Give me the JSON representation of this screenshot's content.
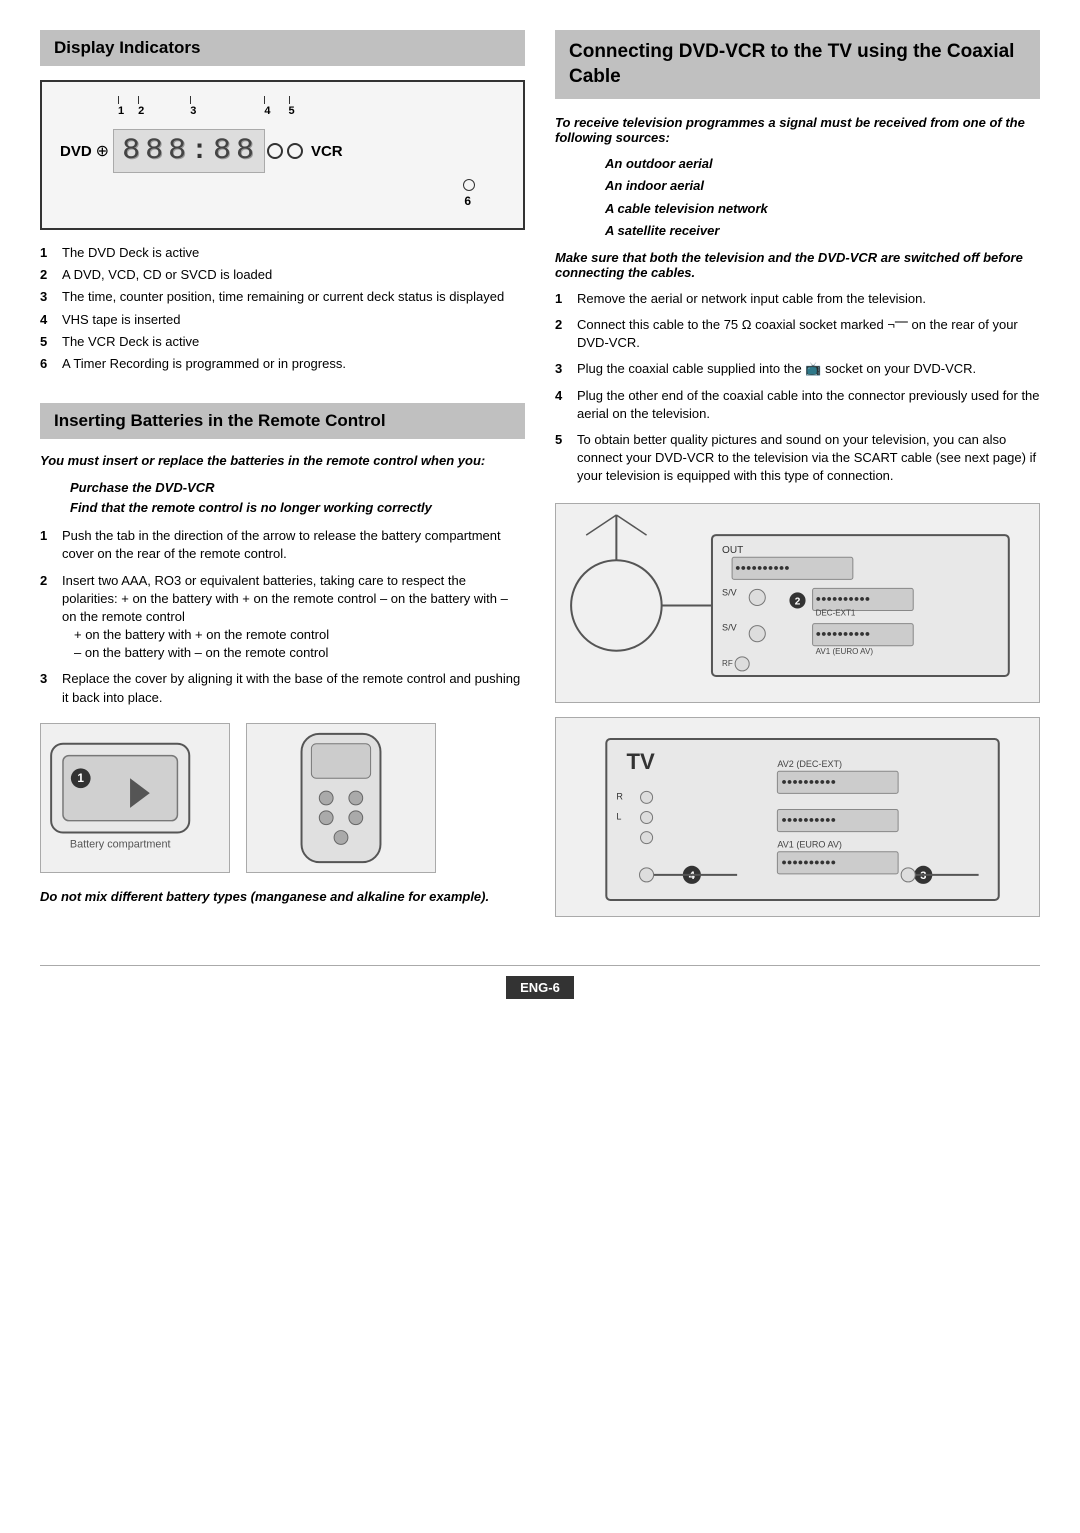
{
  "left": {
    "display_section": {
      "title": "Display Indicators",
      "indicator_numbers": [
        "1",
        "2",
        "3",
        "4",
        "5"
      ],
      "dvd_label": "DVD",
      "vcr_label": "VCR",
      "digits": [
        "8",
        "8",
        "8",
        ":",
        "8",
        "8"
      ],
      "indicator_note_6": "6",
      "items": [
        {
          "num": "1",
          "text": "The DVD Deck is active"
        },
        {
          "num": "2",
          "text": "A DVD, VCD, CD or SVCD is loaded"
        },
        {
          "num": "3",
          "text": "The time, counter position, time remaining or current deck status is displayed"
        },
        {
          "num": "4",
          "text": "VHS tape is inserted"
        },
        {
          "num": "5",
          "text": "The VCR Deck is active"
        },
        {
          "num": "6",
          "text": "A Timer Recording is programmed or in progress."
        }
      ]
    },
    "batteries_section": {
      "title": "Inserting Batteries in the Remote Control",
      "intro": "You must insert or replace the batteries in the remote control when you:",
      "conditions": [
        "Purchase the DVD-VCR",
        "Find that the remote control is no longer working correctly"
      ],
      "steps": [
        {
          "num": "1",
          "text": "Push the tab in the direction of the arrow to release the battery compartment cover on the rear of the remote control."
        },
        {
          "num": "2",
          "text": "Insert two AAA, RO3 or equivalent batteries, taking care to respect the polarities:\n+ on the battery with + on the remote control\n– on the battery with – on the remote control"
        },
        {
          "num": "3",
          "text": "Replace the cover by aligning it with the base of the remote control and pushing it back into place."
        }
      ],
      "plus_line": "+ on the battery with + on the remote control",
      "minus_line": "– on the battery with – on the remote control",
      "warning": "Do not mix different battery types (manganese and alkaline for example)."
    }
  },
  "right": {
    "connecting_section": {
      "title": "Connecting DVD-VCR to the TV using the Coaxial Cable",
      "intro": "To receive television programmes a signal must be received from one of the following sources:",
      "sources": [
        "An outdoor aerial",
        "An indoor aerial",
        "A cable television network",
        "A satellite receiver"
      ],
      "warning": "Make sure that both the television and the DVD-VCR are switched off before connecting the cables.",
      "steps": [
        {
          "num": "1",
          "text": "Remove the aerial or network input cable from the television."
        },
        {
          "num": "2",
          "text": "Connect this cable to the 75 Ω coaxial socket marked ¬― on the rear of your DVD-VCR."
        },
        {
          "num": "3",
          "text": "Plug the coaxial cable supplied into the 📺 socket on your DVD-VCR."
        },
        {
          "num": "4",
          "text": "Plug the other end of the coaxial cable into the connector previously used for the aerial on the television."
        },
        {
          "num": "5",
          "text": "To obtain better quality pictures and sound on your television, you can also connect your DVD-VCR to the television via the SCART cable (see next page) if your television is equipped with this type of connection."
        }
      ]
    }
  },
  "footer": {
    "label": "ENG-6"
  }
}
